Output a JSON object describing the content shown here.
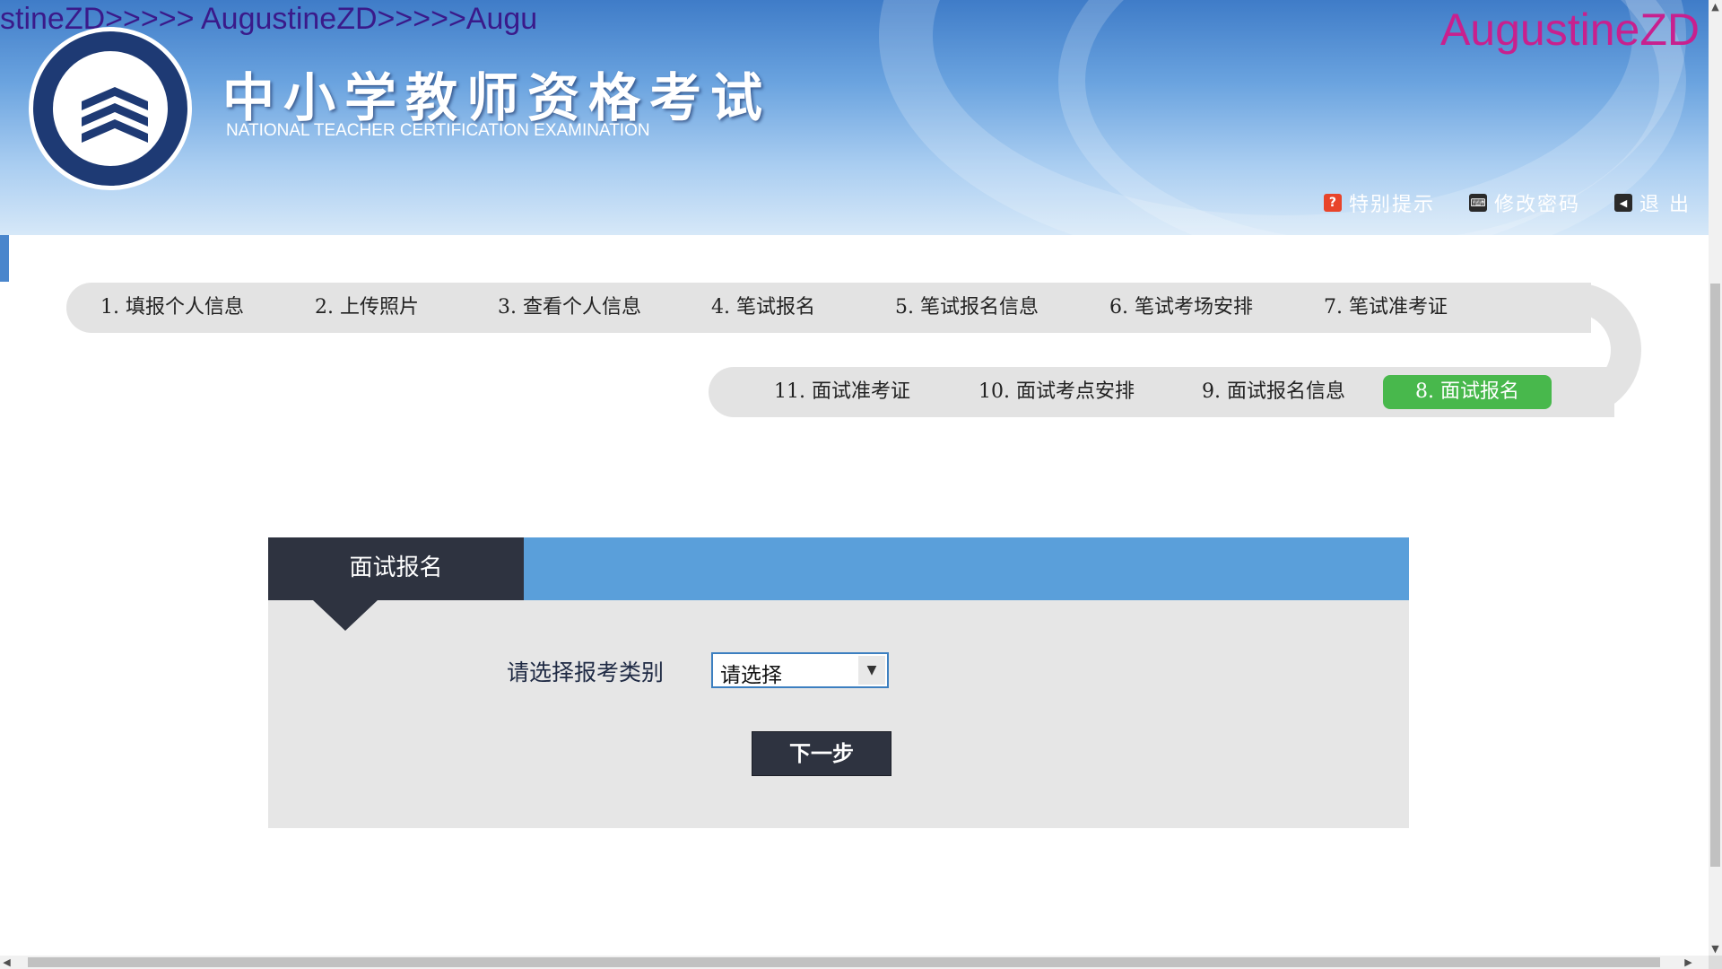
{
  "header": {
    "watermark": "stineZD>>>>> AugustineZD>>>>>Augu",
    "brand_right": "AugustineZD",
    "title_cn": "中小学教师资格考试",
    "title_en": "NATIONAL TEACHER CERTIFICATION EXAMINATION",
    "links": [
      {
        "label": "特别提示",
        "icon": "question-icon",
        "icon_glyph": "?",
        "icon_color": "#e8442a"
      },
      {
        "label": "修改密码",
        "icon": "key-icon",
        "icon_glyph": "⌨",
        "icon_color": "#2a2a2a"
      },
      {
        "label": "退 出",
        "icon": "exit-icon",
        "icon_glyph": "◀",
        "icon_color": "#2a2a2a"
      }
    ]
  },
  "steps": {
    "row1": [
      "1. 填报个人信息",
      "2. 上传照片",
      "3. 查看个人信息",
      "4. 笔试报名",
      "5. 笔试报名信息",
      "6. 笔试考场安排",
      "7. 笔试准考证"
    ],
    "row2": [
      "11. 面试准考证",
      "10. 面试考点安排",
      "9. 面试报名信息",
      "8. 面试报名"
    ],
    "active": "8. 面试报名",
    "active_color": "#48b84c"
  },
  "panel": {
    "tab_title": "面试报名",
    "field_label": "请选择报考类别",
    "select_value": "请选择",
    "next_button": "下一步"
  }
}
